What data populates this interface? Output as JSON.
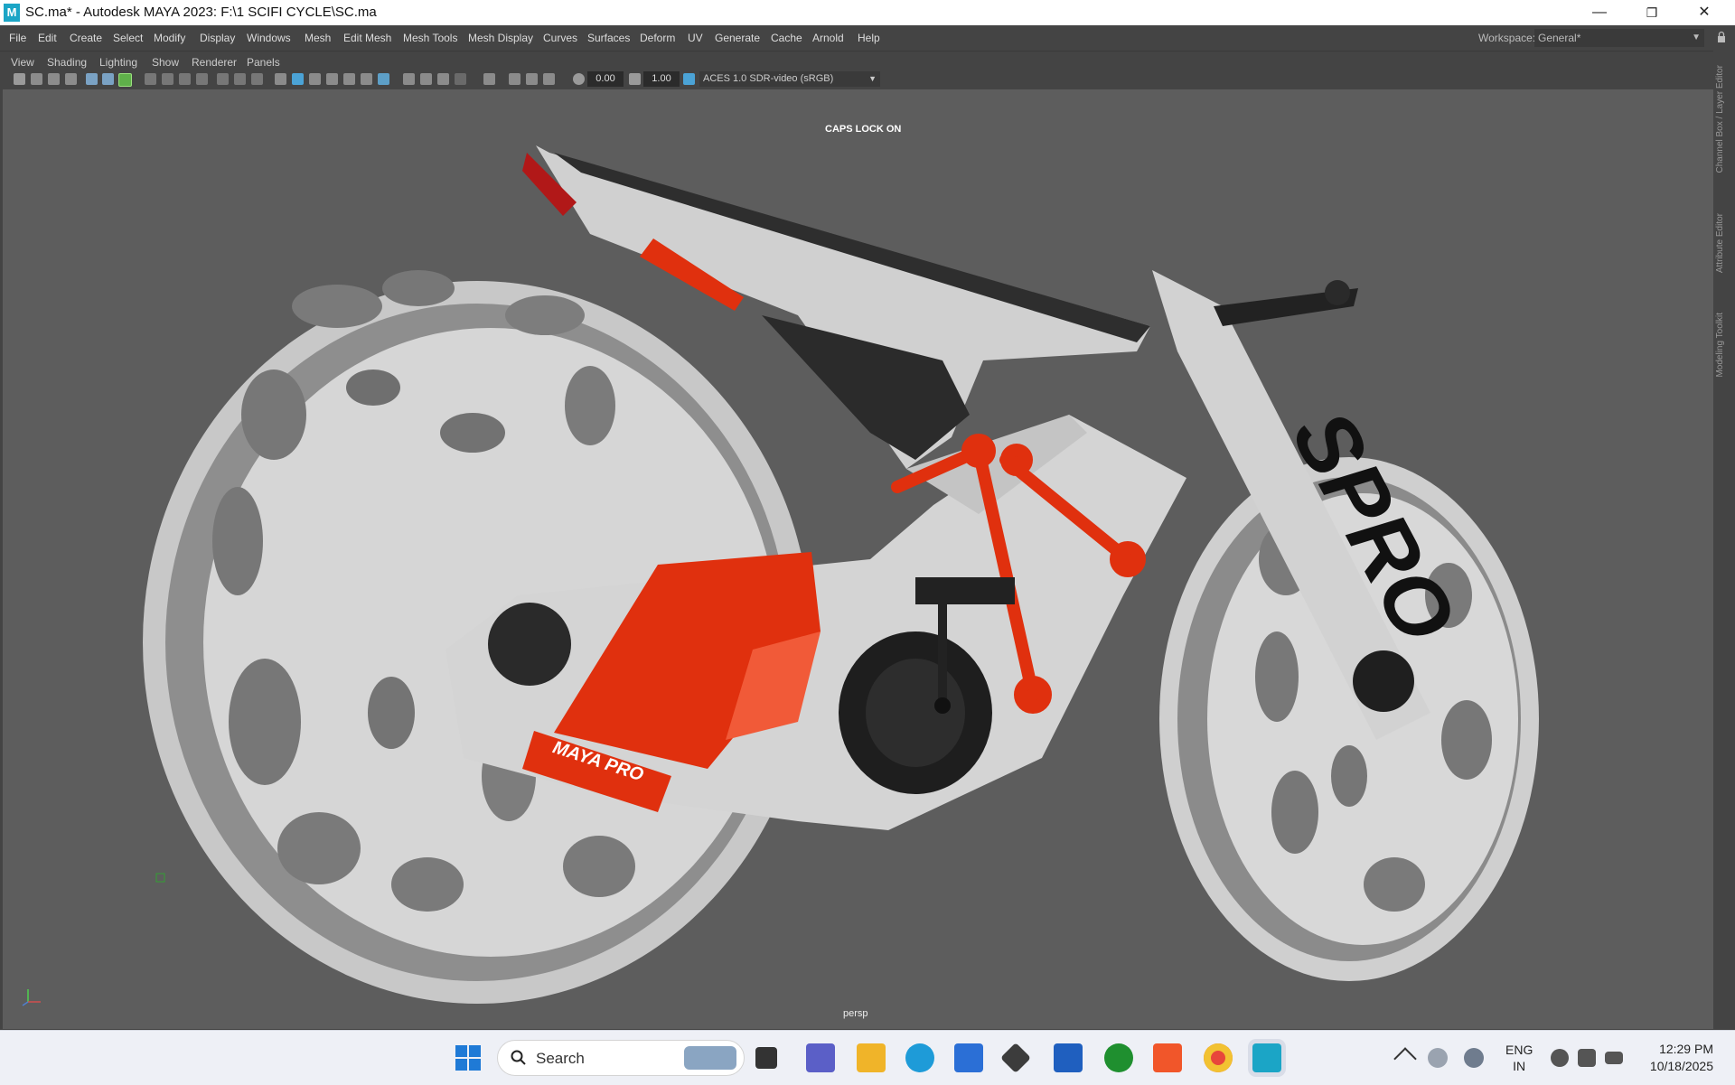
{
  "titlebar": {
    "app_icon_letter": "M",
    "title": "SC.ma* - Autodesk MAYA 2023: F:\\1 SCIFI CYCLE\\SC.ma",
    "minimize": "—",
    "restore": "❐",
    "close": "✕"
  },
  "menubar": {
    "items": [
      "File",
      "Edit",
      "Create",
      "Select",
      "Modify",
      "Display",
      "Windows",
      "Mesh",
      "Edit Mesh",
      "Mesh Tools",
      "Mesh Display",
      "Curves",
      "Surfaces",
      "Deform",
      "UV",
      "Generate",
      "Cache",
      "Arnold",
      "Help"
    ],
    "workspace_label": "Workspace:",
    "workspace_value": "General*"
  },
  "panel_menu": {
    "items": [
      "View",
      "Shading",
      "Lighting",
      "Show",
      "Renderer",
      "Panels"
    ]
  },
  "panel_toolbar": {
    "exposure": "0.00",
    "gamma": "1.00",
    "color_space": "ACES 1.0 SDR-video (sRGB)"
  },
  "viewport": {
    "caps_lock": "CAPS LOCK ON",
    "camera": "persp",
    "model_logo_swingarm": "MAYA PRO",
    "model_logo_fork": "SPRO",
    "colors": {
      "background": "#5d5d5d",
      "body": "#d2d2d2",
      "accent_red": "#e0300e",
      "dark": "#2a2a2a"
    }
  },
  "right_dock": {
    "tabs": [
      "Channel Box / Layer Editor",
      "Attribute Editor",
      "Modeling Toolkit"
    ]
  },
  "taskbar": {
    "search_placeholder": "Search",
    "apps": [
      "windows-start-icon",
      "file-manager-icon",
      "teams-icon",
      "file-explorer-icon",
      "edge-icon",
      "store-icon",
      "unity-icon",
      "affinity-icon",
      "xbox-icon",
      "brave-icon",
      "chrome-icon",
      "maya-icon"
    ],
    "lang_line1": "ENG",
    "lang_line2": "IN",
    "time": "12:29 PM",
    "date": "10/18/2025"
  }
}
